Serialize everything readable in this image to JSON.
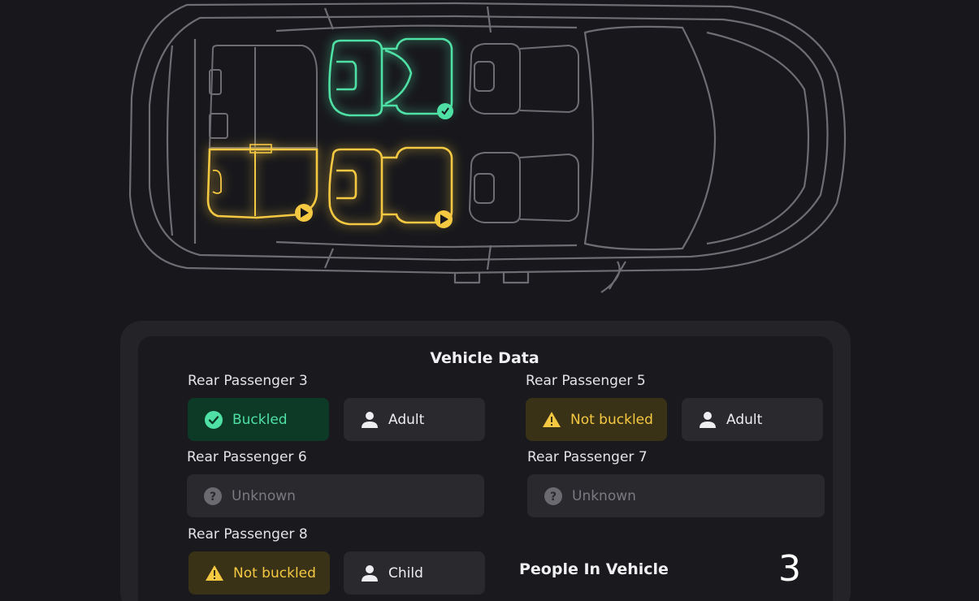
{
  "panel": {
    "title": "Vehicle Data"
  },
  "passengers": [
    {
      "label": "Rear Passenger 3",
      "status": "Buckled",
      "status_type": "ok",
      "occupant": "Adult"
    },
    {
      "label": "Rear Passenger 5",
      "status": "Not buckled",
      "status_type": "warn",
      "occupant": "Adult"
    },
    {
      "label": "Rear Passenger 6",
      "status": "Unknown",
      "status_type": "unknown"
    },
    {
      "label": "Rear Passenger 7",
      "status": "Unknown",
      "status_type": "unknown"
    },
    {
      "label": "Rear Passenger 8",
      "status": "Not buckled",
      "status_type": "warn",
      "occupant": "Child"
    }
  ],
  "summary": {
    "people_label": "People In Vehicle",
    "people_count": "3"
  },
  "seat_map": {
    "buckled_color": "#4fe0a6",
    "warning_color": "#f5c842",
    "outline_color": "#7a7a80",
    "seats": [
      {
        "id": "rear-passenger-3",
        "state": "buckled",
        "badge_icon": "check-icon"
      },
      {
        "id": "rear-passenger-5",
        "state": "not-buckled",
        "badge_icon": "warning-icon"
      },
      {
        "id": "rear-passenger-8",
        "state": "not-buckled",
        "badge_icon": "warning-icon"
      }
    ]
  },
  "colors": {
    "background": "#18181c",
    "panel": "#1a1a1e",
    "buckled": "#4fe0a6",
    "not_buckled": "#f5c842",
    "unknown": "#7a7a80"
  }
}
